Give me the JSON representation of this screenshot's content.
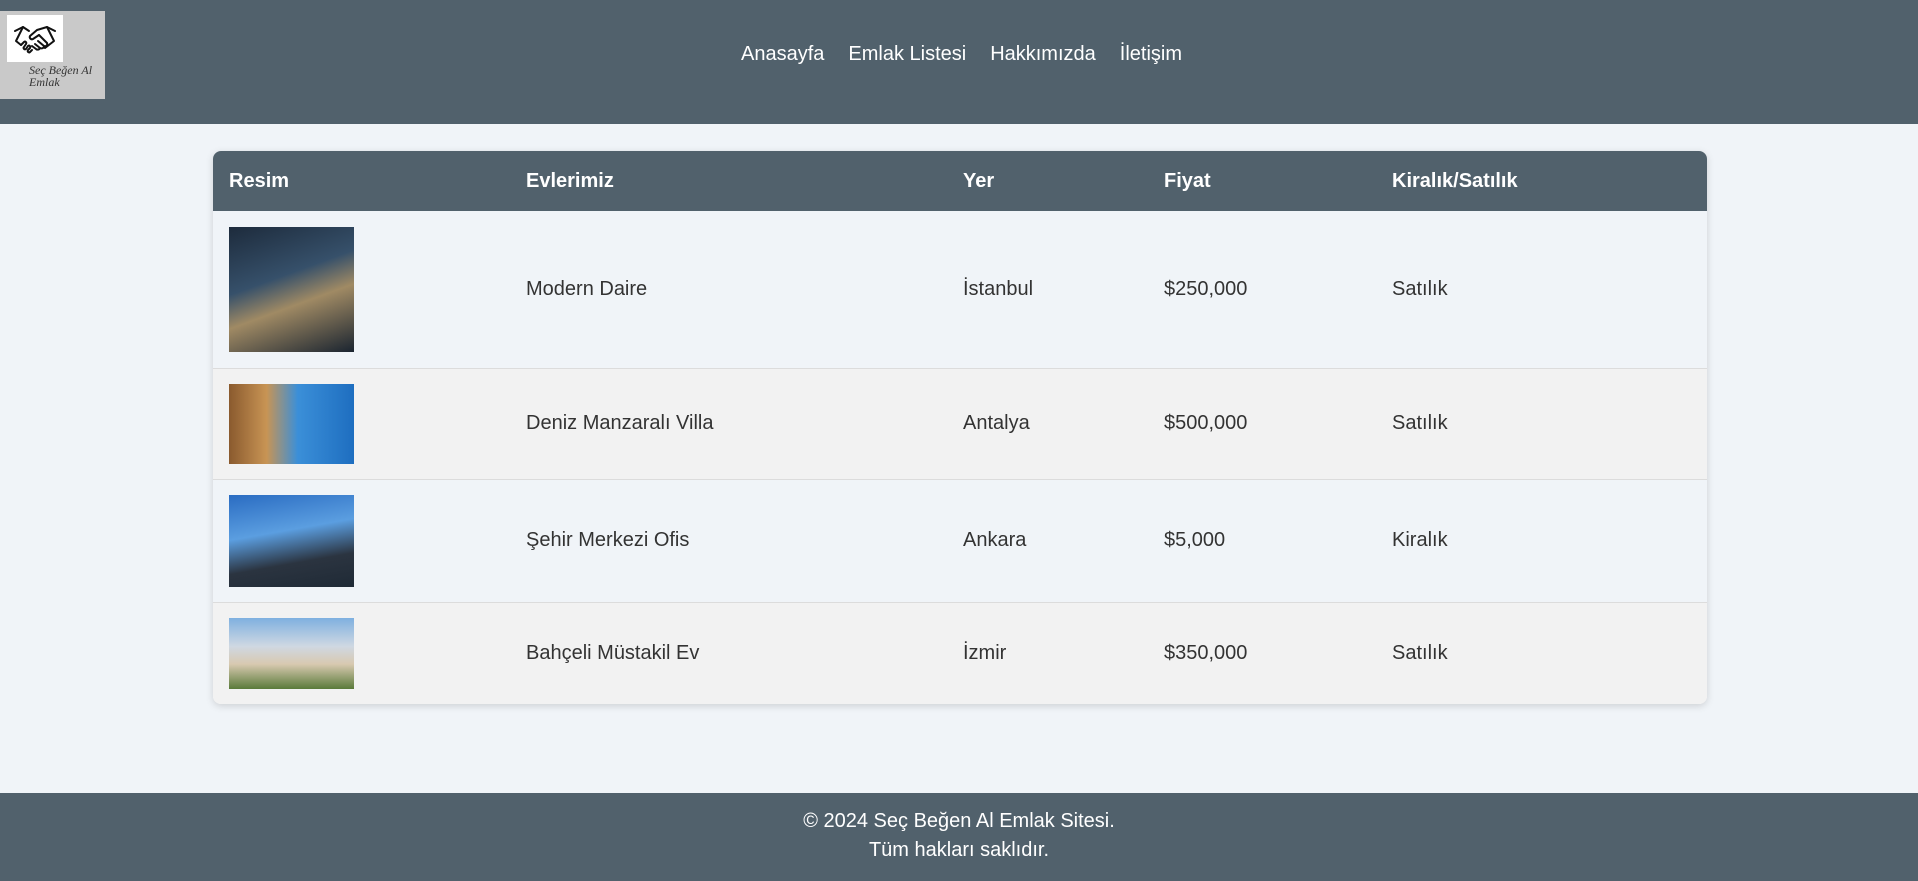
{
  "logo": {
    "icon": "handshake-icon",
    "text": "Seç Beğen Al Emlak"
  },
  "nav": {
    "items": [
      {
        "label": "Anasayfa"
      },
      {
        "label": "Emlak Listesi"
      },
      {
        "label": "Hakkımızda"
      },
      {
        "label": "İletişim"
      }
    ]
  },
  "table": {
    "headers": [
      "Resim",
      "Evlerimiz",
      "Yer",
      "Fiyat",
      "Kiralık/Satılık"
    ],
    "rows": [
      {
        "image": "modern-apartment-building-photo",
        "name": "Modern Daire",
        "location": "İstanbul",
        "price": "$250,000",
        "status": "Satılık"
      },
      {
        "image": "sea-view-villa-terrace-photo",
        "name": "Deniz Manzaralı Villa",
        "location": "Antalya",
        "price": "$500,000",
        "status": "Satılık"
      },
      {
        "image": "city-center-office-building-photo",
        "name": "Şehir Merkezi Ofis",
        "location": "Ankara",
        "price": "$5,000",
        "status": "Kiralık"
      },
      {
        "image": "detached-house-with-garden-photo",
        "name": "Bahçeli Müstakil Ev",
        "location": "İzmir",
        "price": "$350,000",
        "status": "Satılık"
      }
    ]
  },
  "footer": {
    "line1": "© 2024 Seç Beğen Al Emlak Sitesi.",
    "line2": "Tüm hakları saklıdır."
  },
  "colors": {
    "header_bg": "#51616c",
    "page_bg": "#f0f4f8",
    "alt_row_bg": "#f2f2f2"
  }
}
